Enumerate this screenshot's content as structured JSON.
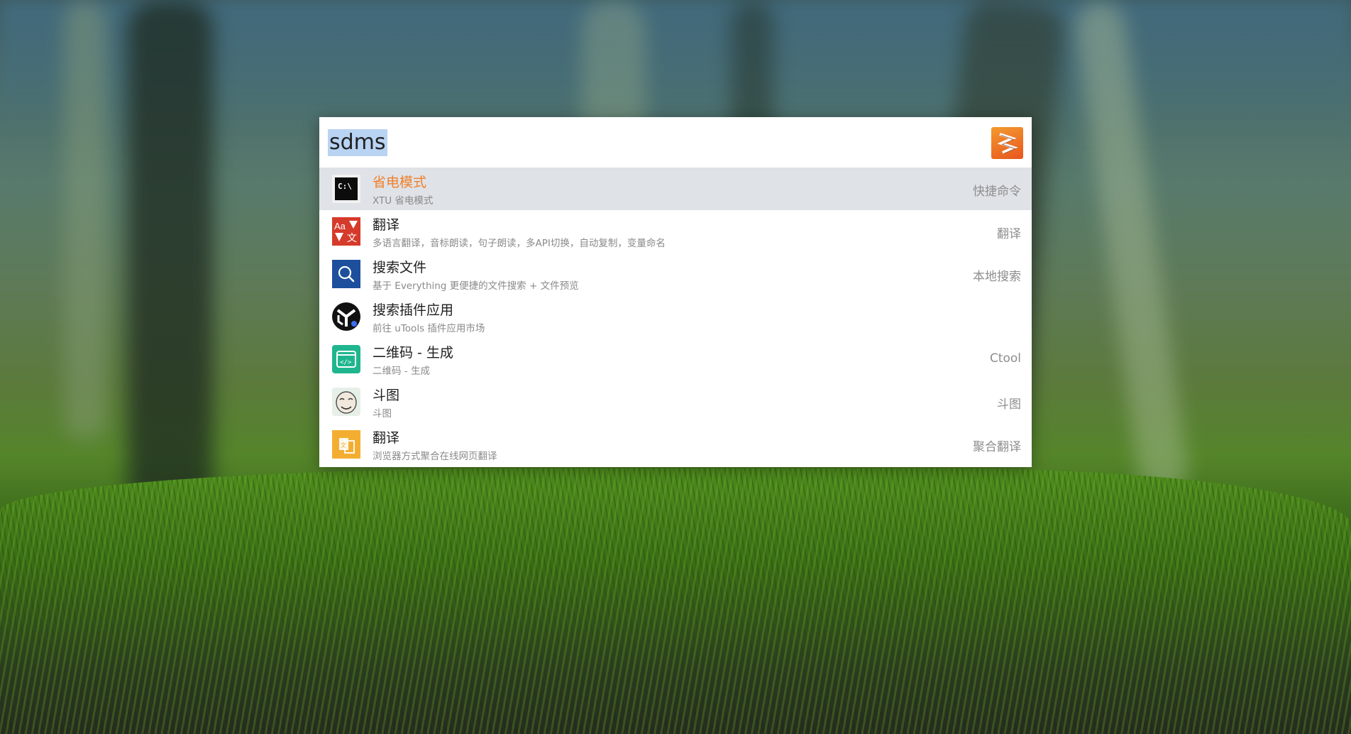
{
  "search": {
    "query": "sdms"
  },
  "app": {
    "logo_icon": "utools-logo-icon",
    "accent": "#f07f2a"
  },
  "results": [
    {
      "title": "省电模式",
      "desc": "XTU 省电模式",
      "tag": "快捷命令",
      "icon": "cmd-terminal-icon",
      "selected": true
    },
    {
      "title": "翻译",
      "desc": "多语言翻译，音标朗读，句子朗读，多API切换，自动复制，变量命名",
      "tag": "翻译",
      "icon": "translate-icon"
    },
    {
      "title": "搜索文件",
      "desc": "基于 Everything 更便捷的文件搜索 + 文件预览",
      "tag": "本地搜索",
      "icon": "file-search-icon"
    },
    {
      "title": "搜索插件应用",
      "desc": "前往 uTools 插件应用市场",
      "tag": "",
      "icon": "plugin-market-icon"
    },
    {
      "title": "二维码 - 生成",
      "desc": "二维码 - 生成",
      "tag": "Ctool",
      "icon": "code-window-icon"
    },
    {
      "title": "斗图",
      "desc": "斗图",
      "tag": "斗图",
      "icon": "meme-face-icon"
    },
    {
      "title": "翻译",
      "desc": "浏览器方式聚合在线网页翻译",
      "tag": "聚合翻译",
      "icon": "aggregate-translate-icon"
    }
  ]
}
